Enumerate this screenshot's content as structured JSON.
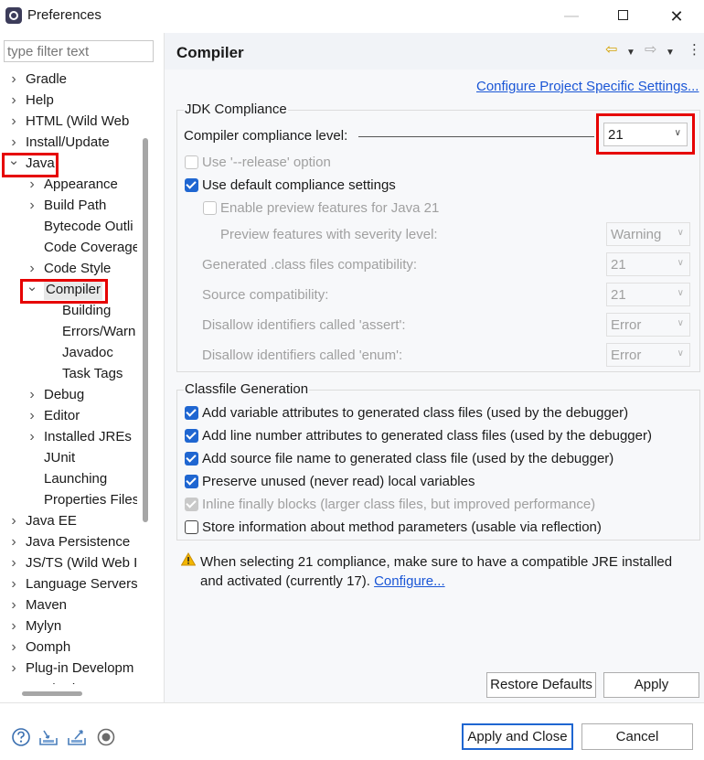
{
  "window": {
    "title": "Preferences",
    "min_glyph": "—",
    "close_glyph": "✕"
  },
  "filter": {
    "placeholder": "type filter text",
    "value": ""
  },
  "tree": [
    {
      "label": "Gradle",
      "level": 0,
      "expander": "collapsed"
    },
    {
      "label": "Help",
      "level": 0,
      "expander": "collapsed"
    },
    {
      "label": "HTML (Wild Web",
      "level": 0,
      "expander": "collapsed"
    },
    {
      "label": "Install/Update",
      "level": 0,
      "expander": "collapsed"
    },
    {
      "label": "Java",
      "level": 0,
      "expander": "expanded",
      "highlight": true
    },
    {
      "label": "Appearance",
      "level": 1,
      "expander": "collapsed"
    },
    {
      "label": "Build Path",
      "level": 1,
      "expander": "collapsed"
    },
    {
      "label": "Bytecode Outli",
      "level": 1,
      "expander": "none"
    },
    {
      "label": "Code Coverage",
      "level": 1,
      "expander": "none"
    },
    {
      "label": "Code Style",
      "level": 1,
      "expander": "collapsed"
    },
    {
      "label": "Compiler",
      "level": 1,
      "expander": "expanded",
      "highlight": true,
      "selected": true
    },
    {
      "label": "Building",
      "level": 2,
      "expander": "none"
    },
    {
      "label": "Errors/Warn",
      "level": 2,
      "expander": "none"
    },
    {
      "label": "Javadoc",
      "level": 2,
      "expander": "none"
    },
    {
      "label": "Task Tags",
      "level": 2,
      "expander": "none"
    },
    {
      "label": "Debug",
      "level": 1,
      "expander": "collapsed"
    },
    {
      "label": "Editor",
      "level": 1,
      "expander": "collapsed"
    },
    {
      "label": "Installed JREs",
      "level": 1,
      "expander": "collapsed"
    },
    {
      "label": "JUnit",
      "level": 1,
      "expander": "none"
    },
    {
      "label": "Launching",
      "level": 1,
      "expander": "none"
    },
    {
      "label": "Properties Files",
      "level": 1,
      "expander": "none"
    },
    {
      "label": "Java EE",
      "level": 0,
      "expander": "collapsed"
    },
    {
      "label": "Java Persistence",
      "level": 0,
      "expander": "collapsed"
    },
    {
      "label": "JS/TS (Wild Web I",
      "level": 0,
      "expander": "collapsed"
    },
    {
      "label": "Language Servers",
      "level": 0,
      "expander": "collapsed"
    },
    {
      "label": "Maven",
      "level": 0,
      "expander": "collapsed"
    },
    {
      "label": "Mylyn",
      "level": 0,
      "expander": "collapsed"
    },
    {
      "label": "Oomph",
      "level": 0,
      "expander": "collapsed"
    },
    {
      "label": "Plug-in Developm",
      "level": 0,
      "expander": "collapsed"
    },
    {
      "label": "Run/Debug",
      "level": 0,
      "expander": "collapsed"
    }
  ],
  "page": {
    "title": "Compiler",
    "configure_link": "Configure Project Specific Settings...",
    "nav": {
      "back_glyph": "⇦",
      "forward_glyph": "⇨",
      "dropdown_glyph": "▼",
      "menu_glyph": "⋮"
    }
  },
  "jdk": {
    "group_title": "JDK Compliance",
    "compliance_label": "Compiler compliance level:",
    "compliance_value": "21",
    "use_release_label": "Use '--release' option",
    "use_default_label": "Use default compliance settings",
    "enable_preview_label": "Enable preview features for Java 21",
    "preview_severity_label": "Preview features with severity level:",
    "preview_severity_value": "Warning",
    "generated_label": "Generated .class files compatibility:",
    "generated_value": "21",
    "source_label": "Source compatibility:",
    "source_value": "21",
    "assert_label": "Disallow identifiers called 'assert':",
    "assert_value": "Error",
    "enum_label": "Disallow identifiers called 'enum':",
    "enum_value": "Error",
    "arrow_glyph": "∨"
  },
  "classfile": {
    "group_title": "Classfile Generation",
    "options": [
      {
        "label": "Add variable attributes to generated class files (used by the debugger)",
        "state": "on"
      },
      {
        "label": "Add line number attributes to generated class files (used by the debugger)",
        "state": "on"
      },
      {
        "label": "Add source file name to generated class file (used by the debugger)",
        "state": "on"
      },
      {
        "label": "Preserve unused (never read) local variables",
        "state": "on"
      },
      {
        "label": "Inline finally blocks (larger class files, but improved performance)",
        "state": "on-disabled"
      },
      {
        "label": "Store information about method parameters (usable via reflection)",
        "state": "off"
      }
    ]
  },
  "warning": {
    "text": "When selecting 21 compliance, make sure to have a compatible JRE installed and activated (currently 17). ",
    "link": "Configure..."
  },
  "buttons": {
    "restore_defaults": "Restore Defaults",
    "apply": "Apply",
    "apply_and_close": "Apply and Close",
    "cancel": "Cancel"
  },
  "bottom_icons": [
    "help-icon",
    "import-icon",
    "export-icon",
    "record-icon"
  ],
  "colors": {
    "accent": "#1f66d1",
    "highlight_box": "#e60000",
    "link": "#1a56d6",
    "warning": "#e8a800"
  }
}
